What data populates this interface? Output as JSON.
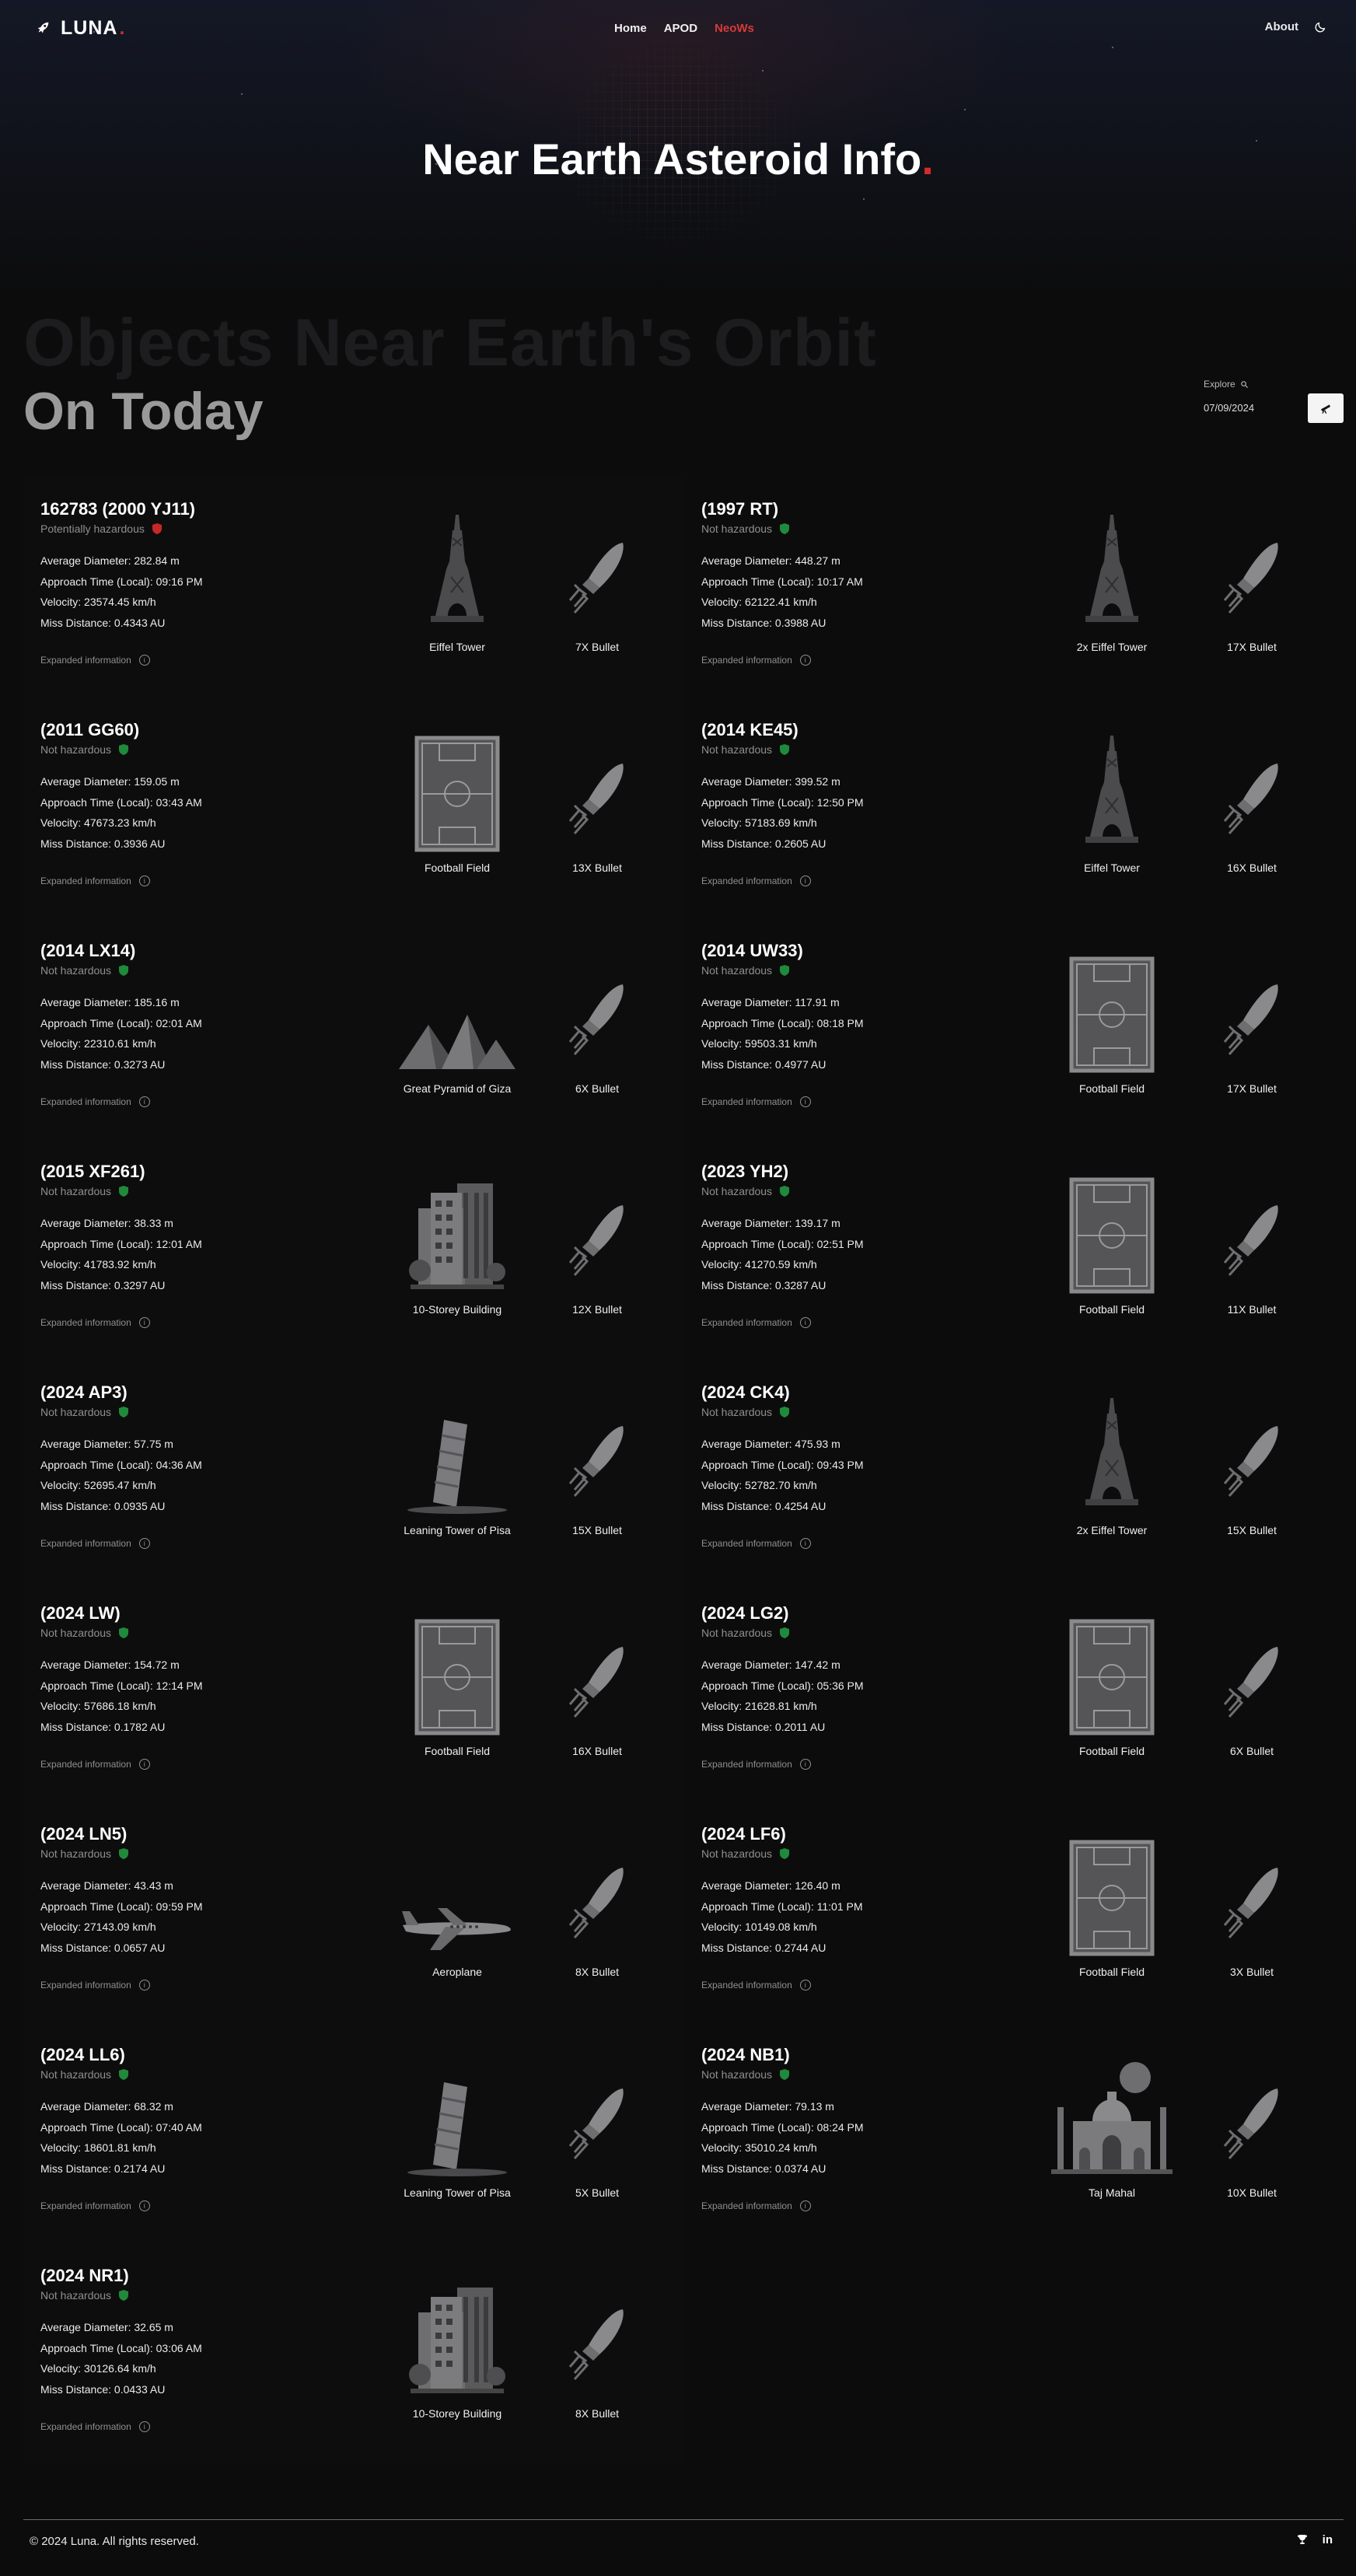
{
  "nav": {
    "logo_text": "LUNA",
    "logo_dot": ".",
    "links": [
      "Home",
      "APOD",
      "NeoWs"
    ],
    "about": "About"
  },
  "hero": {
    "title": "Near Earth Asteroid Info",
    "dot": "."
  },
  "section": {
    "heading": "Objects Near Earth's Orbit",
    "subheading": "On Today",
    "explore_label": "Explore",
    "date_value": "07/09/2024"
  },
  "labels": {
    "avg": "Average Diameter: ",
    "approach": "Approach Time (Local): ",
    "velocity": "Velocity: ",
    "miss": "Miss Distance: ",
    "expanded": "Expanded information"
  },
  "asteroids": [
    {
      "name": "162783 (2000 YJ11)",
      "hazard": "Potentially hazardous",
      "hazardous": true,
      "diameter": "282.84 m",
      "time": "09:16 PM",
      "velocity": "23574.45 km/h",
      "miss": "0.4343 AU",
      "object": "Eiffel Tower",
      "object_icon": "eiffel",
      "bullet": "7X Bullet"
    },
    {
      "name": "(1997 RT)",
      "hazard": "Not hazardous",
      "hazardous": false,
      "diameter": "448.27 m",
      "time": "10:17 AM",
      "velocity": "62122.41 km/h",
      "miss": "0.3988 AU",
      "object": "2x Eiffel Tower",
      "object_icon": "eiffel",
      "bullet": "17X Bullet"
    },
    {
      "name": "(2011 GG60)",
      "hazard": "Not hazardous",
      "hazardous": false,
      "diameter": "159.05 m",
      "time": "03:43 AM",
      "velocity": "47673.23 km/h",
      "miss": "0.3936 AU",
      "object": "Football Field",
      "object_icon": "field",
      "bullet": "13X Bullet"
    },
    {
      "name": "(2014 KE45)",
      "hazard": "Not hazardous",
      "hazardous": false,
      "diameter": "399.52 m",
      "time": "12:50 PM",
      "velocity": "57183.69 km/h",
      "miss": "0.2605 AU",
      "object": "Eiffel Tower",
      "object_icon": "eiffel",
      "bullet": "16X Bullet"
    },
    {
      "name": "(2014 LX14)",
      "hazard": "Not hazardous",
      "hazardous": false,
      "diameter": "185.16 m",
      "time": "02:01 AM",
      "velocity": "22310.61 km/h",
      "miss": "0.3273 AU",
      "object": "Great Pyramid of Giza",
      "object_icon": "pyramid",
      "bullet": "6X Bullet"
    },
    {
      "name": "(2014 UW33)",
      "hazard": "Not hazardous",
      "hazardous": false,
      "diameter": "117.91 m",
      "time": "08:18 PM",
      "velocity": "59503.31 km/h",
      "miss": "0.4977 AU",
      "object": "Football Field",
      "object_icon": "field",
      "bullet": "17X Bullet"
    },
    {
      "name": "(2015 XF261)",
      "hazard": "Not hazardous",
      "hazardous": false,
      "diameter": "38.33 m",
      "time": "12:01 AM",
      "velocity": "41783.92 km/h",
      "miss": "0.3297 AU",
      "object": "10-Storey Building",
      "object_icon": "building",
      "bullet": "12X Bullet"
    },
    {
      "name": "(2023 YH2)",
      "hazard": "Not hazardous",
      "hazardous": false,
      "diameter": "139.17 m",
      "time": "02:51 PM",
      "velocity": "41270.59 km/h",
      "miss": "0.3287 AU",
      "object": "Football Field",
      "object_icon": "field",
      "bullet": "11X Bullet"
    },
    {
      "name": "(2024 AP3)",
      "hazard": "Not hazardous",
      "hazardous": false,
      "diameter": "57.75 m",
      "time": "04:36 AM",
      "velocity": "52695.47 km/h",
      "miss": "0.0935 AU",
      "object": "Leaning Tower of Pisa",
      "object_icon": "pisa",
      "bullet": "15X Bullet"
    },
    {
      "name": "(2024 CK4)",
      "hazard": "Not hazardous",
      "hazardous": false,
      "diameter": "475.93 m",
      "time": "09:43 PM",
      "velocity": "52782.70 km/h",
      "miss": "0.4254 AU",
      "object": "2x Eiffel Tower",
      "object_icon": "eiffel",
      "bullet": "15X Bullet"
    },
    {
      "name": "(2024 LW)",
      "hazard": "Not hazardous",
      "hazardous": false,
      "diameter": "154.72 m",
      "time": "12:14 PM",
      "velocity": "57686.18 km/h",
      "miss": "0.1782 AU",
      "object": "Football Field",
      "object_icon": "field",
      "bullet": "16X Bullet"
    },
    {
      "name": "(2024 LG2)",
      "hazard": "Not hazardous",
      "hazardous": false,
      "diameter": "147.42 m",
      "time": "05:36 PM",
      "velocity": "21628.81 km/h",
      "miss": "0.2011 AU",
      "object": "Football Field",
      "object_icon": "field",
      "bullet": "6X Bullet"
    },
    {
      "name": "(2024 LN5)",
      "hazard": "Not hazardous",
      "hazardous": false,
      "diameter": "43.43 m",
      "time": "09:59 PM",
      "velocity": "27143.09 km/h",
      "miss": "0.0657 AU",
      "object": "Aeroplane",
      "object_icon": "plane",
      "bullet": "8X Bullet"
    },
    {
      "name": "(2024 LF6)",
      "hazard": "Not hazardous",
      "hazardous": false,
      "diameter": "126.40 m",
      "time": "11:01 PM",
      "velocity": "10149.08 km/h",
      "miss": "0.2744 AU",
      "object": "Football Field",
      "object_icon": "field",
      "bullet": "3X Bullet"
    },
    {
      "name": "(2024 LL6)",
      "hazard": "Not hazardous",
      "hazardous": false,
      "diameter": "68.32 m",
      "time": "07:40 AM",
      "velocity": "18601.81 km/h",
      "miss": "0.2174 AU",
      "object": "Leaning Tower of Pisa",
      "object_icon": "pisa",
      "bullet": "5X Bullet"
    },
    {
      "name": "(2024 NB1)",
      "hazard": "Not hazardous",
      "hazardous": false,
      "diameter": "79.13 m",
      "time": "08:24 PM",
      "velocity": "35010.24 km/h",
      "miss": "0.0374 AU",
      "object": "Taj Mahal",
      "object_icon": "taj",
      "bullet": "10X Bullet"
    },
    {
      "name": "(2024 NR1)",
      "hazard": "Not hazardous",
      "hazardous": false,
      "diameter": "32.65 m",
      "time": "03:06 AM",
      "velocity": "30126.64 km/h",
      "miss": "0.0433 AU",
      "object": "10-Storey Building",
      "object_icon": "building",
      "bullet": "8X Bullet"
    }
  ],
  "colors": {
    "accent": "#d52b2b",
    "safe": "#1f8a3b",
    "danger": "#c62828"
  },
  "footer": {
    "copyright": "© 2024 Luna. All rights reserved."
  }
}
